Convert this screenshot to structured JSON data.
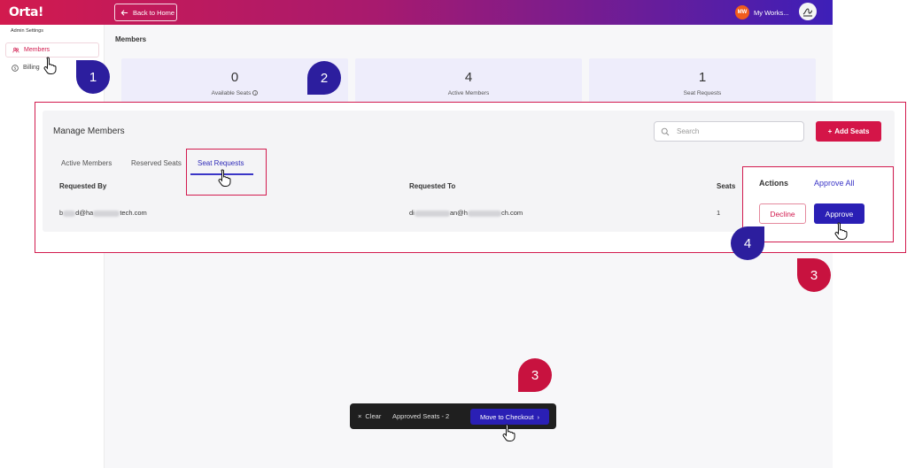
{
  "header": {
    "logo": "Orta!",
    "back_label": "Back to Home",
    "workspace_initials": "MW",
    "workspace_name": "My Works..."
  },
  "sidebar": {
    "section_label": "Admin Settings",
    "items": [
      {
        "label": "Members",
        "icon": "people-icon"
      },
      {
        "label": "Billing",
        "icon": "dollar-icon"
      }
    ]
  },
  "page": {
    "title": "Members"
  },
  "stats": [
    {
      "value": "0",
      "label": "Available Seats"
    },
    {
      "value": "4",
      "label": "Active Members"
    },
    {
      "value": "1",
      "label": "Seat Requests"
    }
  ],
  "manage": {
    "title": "Manage Members",
    "search_placeholder": "Search",
    "add_label": "Add Seats",
    "tabs": [
      "Active Members",
      "Reserved Seats",
      "Seat Requests"
    ],
    "columns": {
      "requested_by": "Requested By",
      "requested_to": "Requested To",
      "seats": "Seats",
      "actions": "Actions"
    },
    "approve_all": "Approve All",
    "row": {
      "by_prefix": "b",
      "by_mid": "d@ha",
      "by_suffix": "tech.com",
      "to_prefix": "di",
      "to_mid": "an@h",
      "to_suffix": "ch.com",
      "seats": "1",
      "decline": "Decline",
      "approve": "Approve"
    }
  },
  "bottom_bar": {
    "clear": "Clear",
    "approved": "Approved Seats - 2",
    "checkout": "Move to Checkout"
  },
  "callouts": [
    "1",
    "2",
    "3",
    "4",
    "3"
  ],
  "colors": {
    "accent_red": "#d21a4e",
    "accent_blue": "#2a1fb5",
    "stat_bg": "#eeedfb"
  }
}
